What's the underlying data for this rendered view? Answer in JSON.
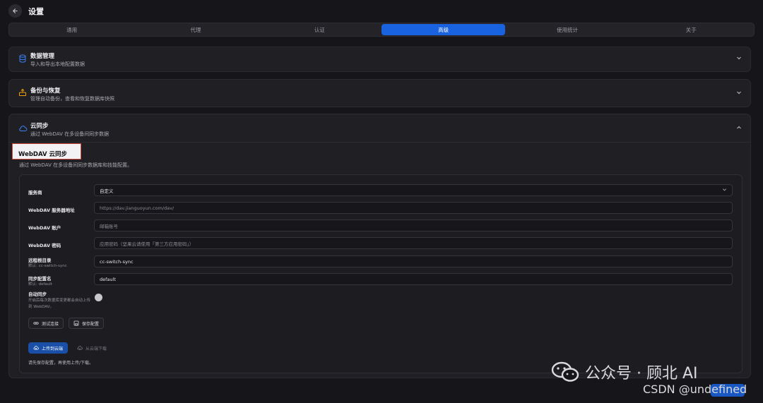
{
  "header": {
    "title": "设置",
    "back_icon": "arrow-left-icon"
  },
  "tabs": [
    {
      "label": "通用",
      "active": false
    },
    {
      "label": "代理",
      "active": false
    },
    {
      "label": "认证",
      "active": false
    },
    {
      "label": "高级",
      "active": true
    },
    {
      "label": "使用统计",
      "active": false
    },
    {
      "label": "关于",
      "active": false
    }
  ],
  "sections": [
    {
      "title": "数据管理",
      "desc": "导入和导出本地配置数据",
      "icon": "database-icon",
      "expanded": false
    },
    {
      "title": "备份与恢复",
      "desc": "管理自动备份，查看和恢复数据库快照",
      "icon": "backup-icon",
      "expanded": false
    },
    {
      "title": "云同步",
      "desc": "通过 WebDAV 在多设备间同步数据",
      "icon": "cloud-icon",
      "expanded": true
    }
  ],
  "webdav": {
    "title": "WebDAV 云同步",
    "desc": "通过 WebDAV 在多设备间同步数据库和技能配置。",
    "fields": {
      "provider": {
        "label": "服务商",
        "value": "自定义"
      },
      "server": {
        "label": "WebDAV 服务器地址",
        "placeholder": "https://dav.jianguoyun.com/dav/"
      },
      "account": {
        "label": "WebDAV 账户",
        "placeholder": "邮箱账号"
      },
      "password": {
        "label": "WebDAV 密码",
        "placeholder": "应用密码（坚果云请使用「第三方应用密码」）"
      },
      "remote_dir": {
        "label": "远程根目录",
        "sub": "默认: cc-switch-sync",
        "value": "cc-switch-sync"
      },
      "profile": {
        "label": "同步配置名",
        "sub": "默认: default",
        "value": "default"
      },
      "auto_sync": {
        "label": "自动同步",
        "sub_line1": "开启后每次数据库变更都会自动上传",
        "sub_line2": "到 WebDAV。",
        "enabled": false
      }
    },
    "buttons": {
      "test": "测试连接",
      "save": "保存配置",
      "upload": "上传到云端",
      "download": "从云端下载"
    },
    "hint": "请先保存配置，再使用上传/下载。"
  },
  "watermark": {
    "text": "公众号 · 顾北 AI",
    "csdn": "CSDN @undefined"
  },
  "colors": {
    "accent": "#1a63e0",
    "highlight_box": "#d04a3a",
    "background": "#16161a"
  }
}
